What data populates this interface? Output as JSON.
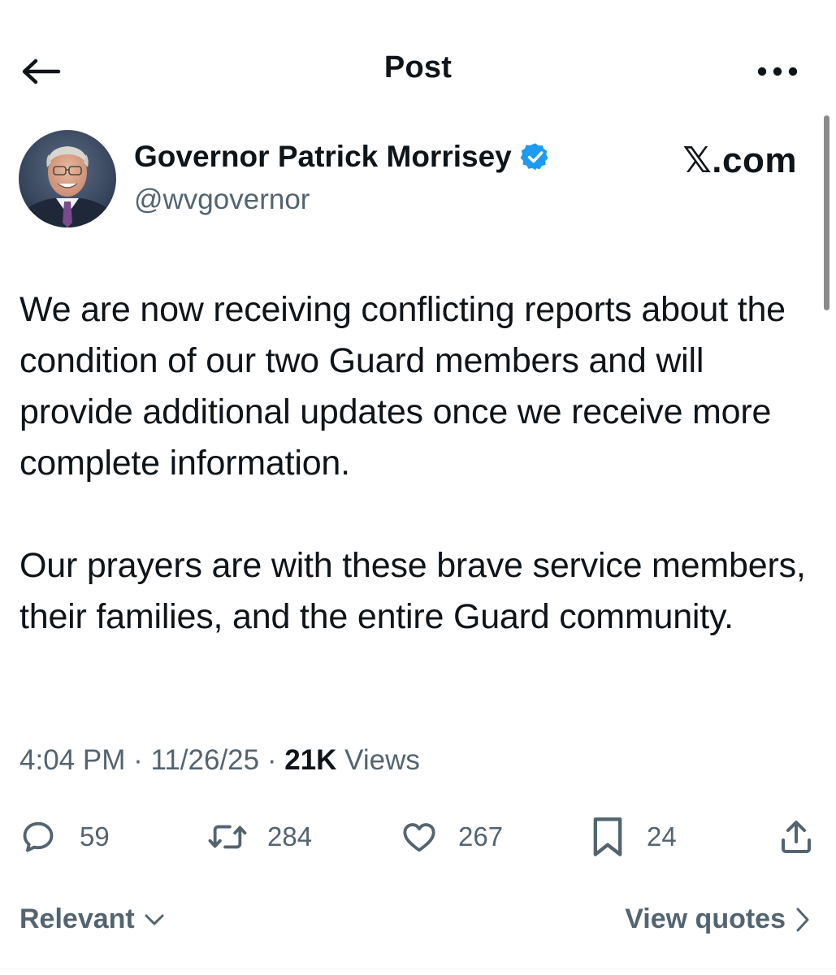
{
  "header": {
    "title": "Post",
    "back_icon": "arrow-left-icon",
    "more_icon": "more-horizontal-icon"
  },
  "author": {
    "name": "Governor Patrick Morrisey",
    "handle": "@wvgovernor",
    "verified": true,
    "verified_color": "#1d9bf0"
  },
  "watermark": "𝕏.com",
  "post": {
    "paragraphs": [
      "We are now receiving conflicting reports about the condition of our two Guard members and will provide additional updates once we receive more complete information.",
      "Our prayers are with these brave service members, their families, and the entire Guard community."
    ]
  },
  "meta": {
    "time": "4:04 PM",
    "sep1": " · ",
    "date": "11/26/25",
    "sep2": " · ",
    "views_count": "21K",
    "views_label": " Views"
  },
  "actions": {
    "replies": "59",
    "reposts": "284",
    "likes": "267",
    "bookmarks": "24"
  },
  "bottom": {
    "sort_label": "Relevant",
    "quotes_label": "View quotes"
  },
  "colors": {
    "text": "#0f1419",
    "secondary": "#536471",
    "verified": "#1d9bf0"
  }
}
